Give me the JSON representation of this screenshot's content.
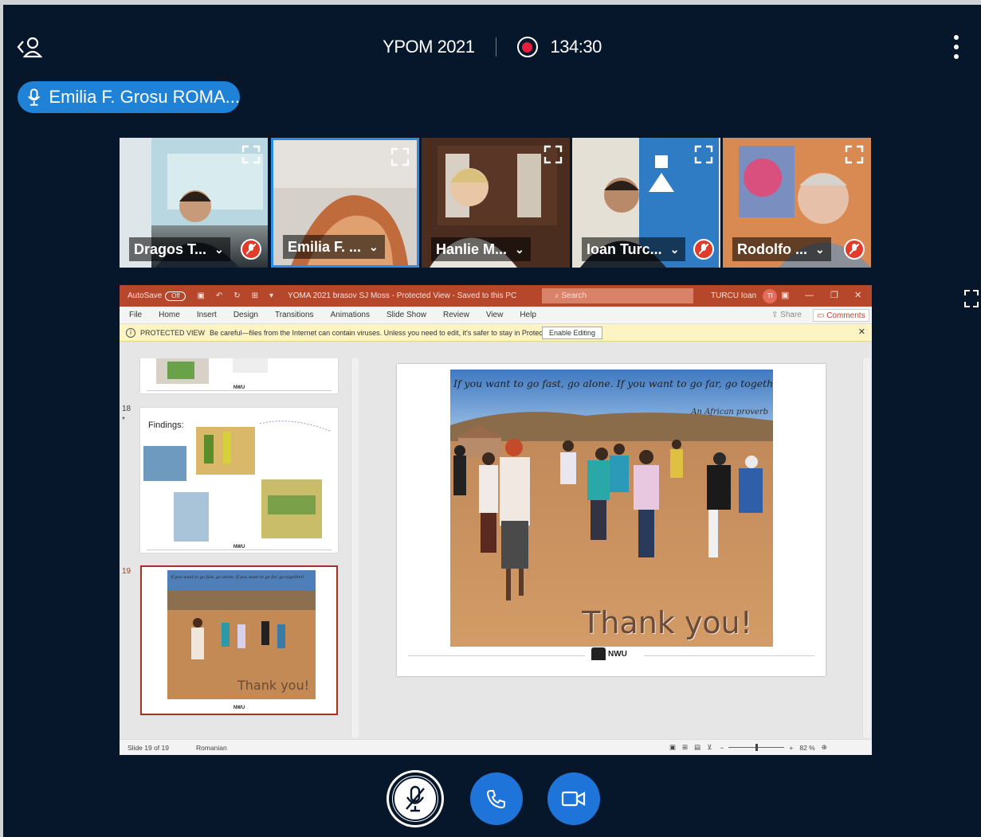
{
  "header": {
    "users_icon": "user-list-icon",
    "meeting_title": "YPOM 2021",
    "recording_icon": "record-icon",
    "recording_time": "134:30",
    "menu_icon": "more-vertical-icon"
  },
  "speaker": {
    "icon": "microphone-icon",
    "name": "Emilia F. Grosu ROMA..."
  },
  "participants": [
    {
      "name": "Dragos T...",
      "muted": true
    },
    {
      "name": "Emilia F. ...",
      "muted": false,
      "active": true
    },
    {
      "name": "Hanlie M...",
      "muted": false
    },
    {
      "name": "Ioan Turc...",
      "muted": true
    },
    {
      "name": "Rodolfo ...",
      "muted": true
    }
  ],
  "ppt": {
    "autosave_label": "AutoSave",
    "autosave_state": "Off",
    "doc_title": "YOMA 2021 brasov SJ Moss  -  Protected View  -  Saved to this PC",
    "search_placeholder": "Search",
    "user_name": "TURCU Ioan",
    "user_initials": "TI",
    "ribbon_tabs": [
      "File",
      "Home",
      "Insert",
      "Design",
      "Transitions",
      "Animations",
      "Slide Show",
      "Review",
      "View",
      "Help"
    ],
    "share_label": "Share",
    "comments_label": "Comments",
    "protected_label": "PROTECTED VIEW",
    "protected_message": "Be careful—files from the Internet can contain viruses. Unless you need to edit, it's safer to stay in Protected View.",
    "enable_editing_label": "Enable Editing",
    "thumb_18_num": "18",
    "thumb_18_title": "Findings:",
    "thumb_19_num": "19",
    "slide_quote": "If you want to go fast, go alone. If you want to go far, go together!",
    "slide_proverb": "An African proverb",
    "slide_thanks": "Thank you!",
    "logo_text": "NWU",
    "slide_counter": "Slide 19 of 19",
    "language": "Romanian",
    "zoom": "82 %"
  },
  "controls": {
    "mic_icon": "microphone-muted-icon",
    "phone_icon": "phone-hangup-icon",
    "video_icon": "video-camera-icon"
  }
}
